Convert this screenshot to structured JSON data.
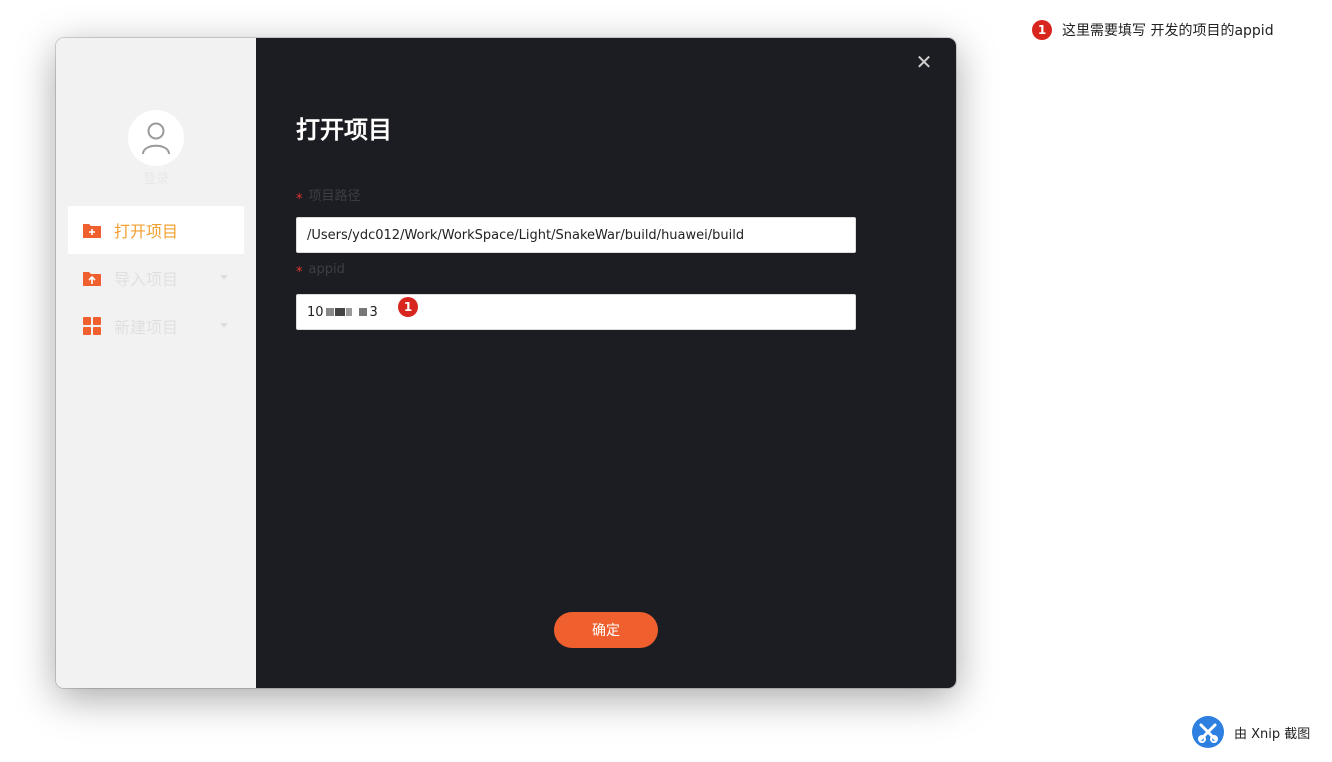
{
  "sidebar": {
    "login_label": "登录",
    "items": [
      {
        "label": "打开项目",
        "icon": "folder-plus-icon",
        "active": true
      },
      {
        "label": "导入项目",
        "icon": "folder-upload-icon",
        "active": false
      },
      {
        "label": "新建项目",
        "icon": "grid-icon",
        "active": false
      }
    ]
  },
  "dialog": {
    "title": "打开项目",
    "close_icon": "close-icon",
    "required_mark": "*",
    "path_label": "项目路径",
    "path_value": "/Users/ydc012/Work/WorkSpace/Light/SnakeWar/build/huawei/build",
    "appid_label": "appid",
    "appid_prefix": "10",
    "appid_suffix": "3",
    "confirm_label": "确定"
  },
  "annotation": {
    "badge_number": "1",
    "text": "这里需要填写 开发的项目的appid"
  },
  "watermark": {
    "text": "由 Xnip 截图"
  },
  "colors": {
    "accent_orange": "#f0602e",
    "active_text": "#f0a030",
    "badge_red": "#d8261f",
    "dialog_bg": "#1c1d22",
    "sidebar_bg": "#f2f2f2"
  }
}
